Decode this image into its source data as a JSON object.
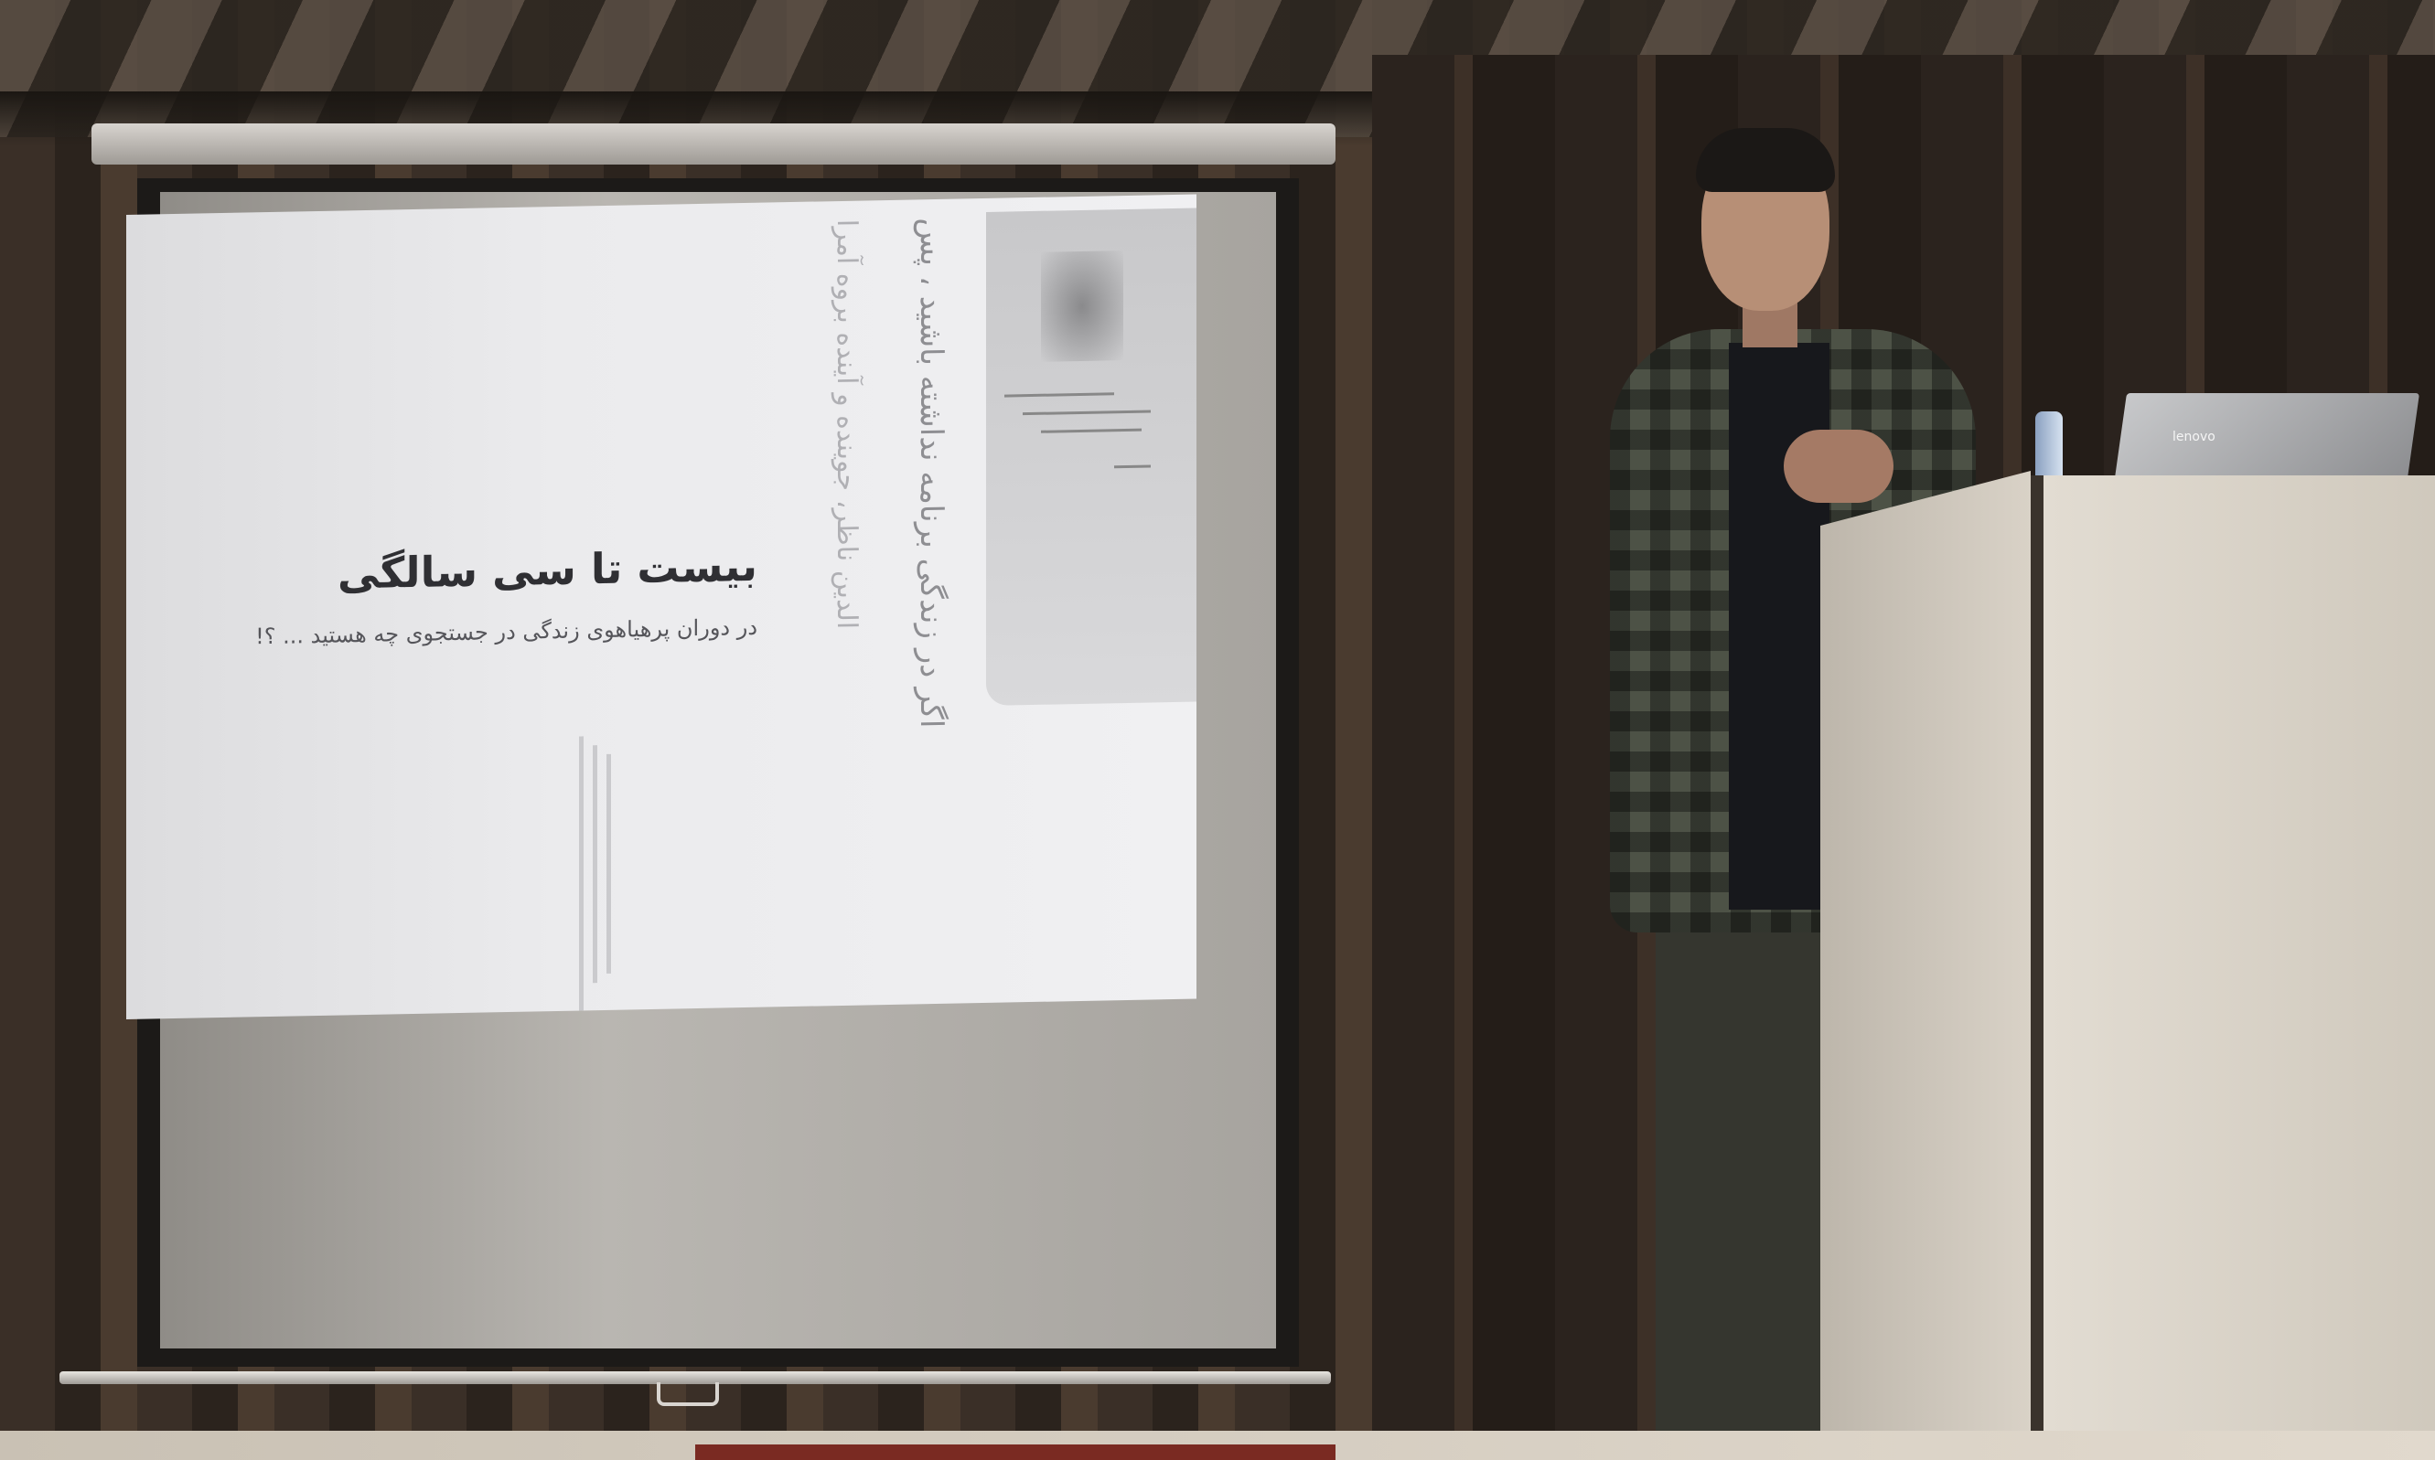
{
  "slide": {
    "title": "بیست تا سی سالگی",
    "subtitle": "در دوران پرهیاهوی زندگی در جستجوی چه هستید ... ؟!",
    "vertical_line_1": "اگر در زندگی برنامه نداشته باشید ، پس",
    "vertical_line_2": "الدین ناظر، جوینده و آینده بروه آمرا"
  },
  "laptop": {
    "brand": "lenovo"
  },
  "colors": {
    "slide_bg": "#ececee",
    "slide_title": "#2f2f33",
    "podium": "#ddd6cb",
    "wall": "#332a23"
  }
}
